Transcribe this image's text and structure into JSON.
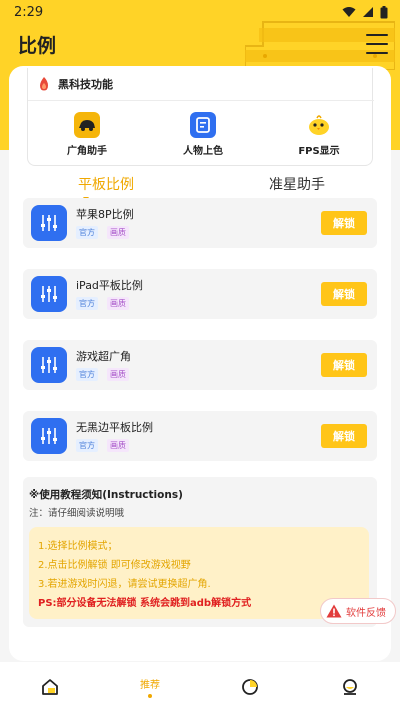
{
  "status_bar": {
    "time": "2:29"
  },
  "header": {
    "title": "比例"
  },
  "features": {
    "heading": "黑科技功能",
    "items": [
      {
        "label": "广角助手",
        "icon": "car-icon"
      },
      {
        "label": "人物上色",
        "icon": "document-icon"
      },
      {
        "label": "FPS显示",
        "icon": "chick-icon"
      }
    ]
  },
  "tabs": [
    {
      "label": "平板比例",
      "active": true
    },
    {
      "label": "准星助手",
      "active": false
    }
  ],
  "ratio_items": [
    {
      "title": "苹果8P比例",
      "tags": [
        "官方",
        "画质"
      ],
      "button": "解锁"
    },
    {
      "title": "iPad平板比例",
      "tags": [
        "官方",
        "画质"
      ],
      "button": "解锁"
    },
    {
      "title": "游戏超广角",
      "tags": [
        "官方",
        "画质"
      ],
      "button": "解锁"
    },
    {
      "title": "无黑边平板比例",
      "tags": [
        "官方",
        "画质"
      ],
      "button": "解锁"
    }
  ],
  "instructions": {
    "title": "※使用教程须知(Instructions)",
    "note": "注：请仔细阅读说明哦",
    "lines": [
      "1.选择比例模式；",
      "2.点击比例解锁 即可修改游戏视野",
      "3.若进游戏时闪退，请尝试更换超广角."
    ],
    "ps": "PS:部分设备无法解锁 系统会跳到adb解锁方式"
  },
  "feedback": {
    "label": "软件反馈"
  },
  "bottom_nav": [
    {
      "label": "",
      "icon": "home-icon",
      "active": false
    },
    {
      "label": "推荐",
      "icon": "",
      "active": true
    },
    {
      "label": "",
      "icon": "pie-chart-icon",
      "active": false
    },
    {
      "label": "",
      "icon": "profile-icon",
      "active": false
    }
  ],
  "colors": {
    "header_yellow": "#ffd327",
    "accent_orange": "#f0a800",
    "unlock_button": "#ffc518",
    "icon_blue": "#2f6ff0",
    "warning_red": "#e02020"
  }
}
